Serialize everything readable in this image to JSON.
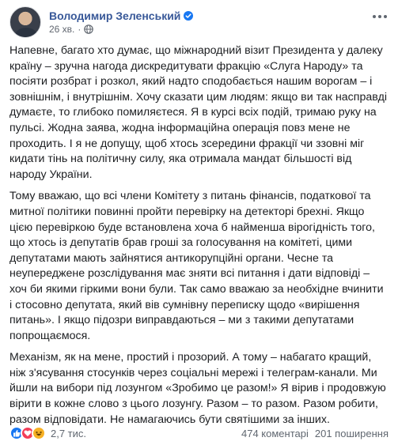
{
  "post": {
    "author": "Володимир Зеленський",
    "time": "26 хв.",
    "paragraphs": [
      "Напевне, багато хто думає, що міжнародний візит Президента у далеку країну – зручна нагода дискредитувати фракцію «Слуга Народу» та посіяти розбрат і розкол, який надто сподобається нашим ворогам – і зовнішнім, і внутрішнім. Хочу сказати цим людям: якщо ви так насправді думаєте, то глибоко помиляєтеся. Я в курсі всіх подій, тримаю руку на пульсі. Жодна заява, жодна інформаційна операція повз мене не проходить. І я не допущу, щоб хтось зсередини фракції чи ззовні міг кидати тінь на політичну силу, яка отримала мандат більшості від народу України.",
      "Тому вважаю, що всі члени Комітету з питань фінансів, податкової та митної політики повинні пройти перевірку на детекторі брехні. Якщо цією перевіркою буде встановлена хоча б найменша вірогідність того, що хтось із депутатів брав гроші за голосування на комітеті, цими депутатами мають зайнятися антикорупційні органи. Чесне та неупереджене розслідування має зняти всі питання і дати відповіді – хоч би якими гіркими вони були. Так само вважаю за необхідне вчинити і стосовно депутата, який вів сумнівну переписку щодо «вирішення питань». І якщо підозри виправдаються – ми з такими депутатами попрощаємося.",
      "Механізм, як на мене, простий і прозорий. А тому – набагато кращий, ніж з'ясування стосунків через соціальні мережі і телеграм-канали. Ми йшли на вибори під лозунгом «Зробимо це разом!» Я вірив і продовжую вірити в кожне слово з цього лозунгу. Разом – то разом. Разом робити, разом відповідати. Не намагаючись бути святішими за інших."
    ]
  },
  "footer": {
    "reactions_count": "2,7 тис.",
    "comments": "474 коментарі",
    "shares": "201 поширення",
    "reaction_icons": [
      "like-icon",
      "love-icon",
      "haha-icon"
    ]
  },
  "colors": {
    "author": "#385898",
    "meta": "#616770",
    "text": "#1c1e21",
    "like": "#1877f2",
    "love": "#f33e58",
    "haha": "#f7b125"
  }
}
